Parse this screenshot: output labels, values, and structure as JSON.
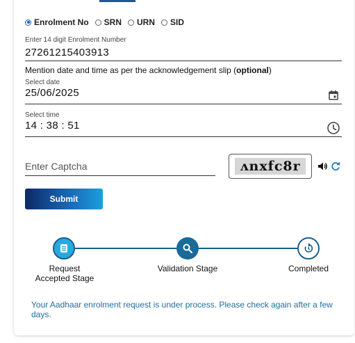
{
  "radio_options": [
    {
      "label": "Enrolment No",
      "checked": true
    },
    {
      "label": "SRN",
      "checked": false
    },
    {
      "label": "URN",
      "checked": false
    },
    {
      "label": "SID",
      "checked": false
    }
  ],
  "enrolment": {
    "label": "Enter 14 digit Enrolment Number",
    "value": "27261215403913"
  },
  "mention": {
    "text": "Mention date and time as per the acknowledgement slip (",
    "bold": "optional",
    "close": ")"
  },
  "date_field": {
    "label": "Select date",
    "value": "25/06/2025",
    "icon": "calendar-icon"
  },
  "time_field": {
    "label": "Select time",
    "value": "14 : 38 : 51",
    "icon": "clock-icon"
  },
  "captcha": {
    "placeholder": "Enter Captcha",
    "image_text": "ʌnxfc8r",
    "audio_icon": "speaker-icon",
    "refresh_icon": "refresh-icon"
  },
  "submit_label": "Submit",
  "steps": [
    {
      "label_line1": "Request",
      "label_line2": "Accepted Stage",
      "state": "done",
      "icon": "document-icon"
    },
    {
      "label_line1": "Validation Stage",
      "label_line2": "",
      "state": "active",
      "icon": "search-icon"
    },
    {
      "label_line1": "Completed",
      "label_line2": "",
      "state": "pending",
      "icon": "refresh-arrow-icon"
    }
  ],
  "status_message": "Your Aadhaar enrolment request is under process. Please check again after a few days.",
  "colors": {
    "accent": "#1a5e8c",
    "step_done": "#29a8df",
    "status_text": "#1e6ea0"
  }
}
